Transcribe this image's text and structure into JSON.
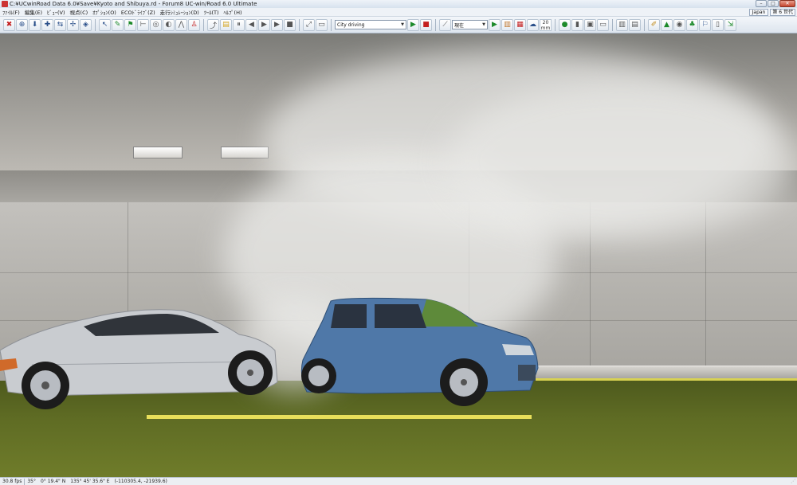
{
  "window": {
    "title": "C:¥UCwinRoad Data 6.0¥Save¥Kyoto and Shibuya.rd - Forum8 UC-win/Road 6.0 Ultimate",
    "controls": [
      "minimize",
      "maximize",
      "close"
    ]
  },
  "menu": {
    "items": [
      "ﾌｧｲﾙ(F)",
      "編集(E)",
      "ﾋﾞｭｰ(V)",
      "視点(C)",
      "ｵﾌﾟｼｮﾝ(O)",
      "ECOﾄﾞﾗｲﾌﾞ(Z)",
      "走行ｼﾐｭﾚｰｼｮﾝ(D)",
      "ﾂｰﾙ(T)",
      "ﾍﾙﾌﾟ(H)"
    ],
    "language": "Japan",
    "ime": "第 6 世代"
  },
  "toolbar": {
    "scenario_select": "City driving",
    "view_select": "現在",
    "zoom_label": "20",
    "zoom_sub": "mm"
  },
  "status": {
    "fps": "30.8 fps",
    "heading": "35°",
    "latitude": "0° 19.4\" N",
    "longitude": "135° 45' 35.6\" E",
    "position": "(-110305.4, -21939.6)"
  },
  "colors": {
    "wall": "#b2b0ab",
    "ground": "#5f6c24",
    "lane_marking": "#e8df5a",
    "silver_car": "#c9ccd0",
    "blue_car": "#4f78a8"
  }
}
